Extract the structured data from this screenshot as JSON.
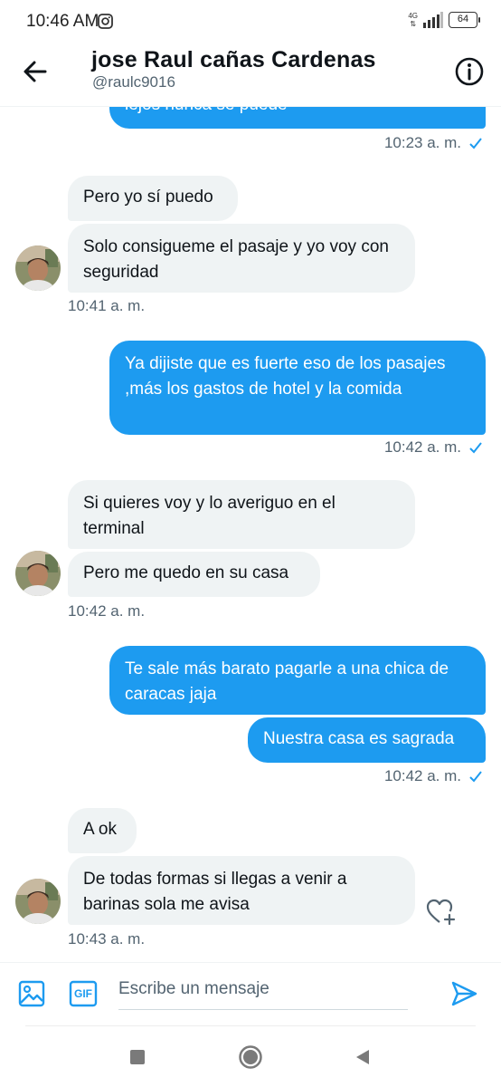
{
  "status_bar": {
    "time": "10:46 AM",
    "network": "4G",
    "battery": "64",
    "icons": [
      "instagram-icon",
      "signal-icon",
      "battery-icon"
    ]
  },
  "header": {
    "name": "jose Raul cañas Cardenas",
    "handle": "@raulc9016",
    "back_icon": "arrow-left-icon",
    "info_icon": "info-circle-icon"
  },
  "colors": {
    "accent": "#1d9bf0",
    "received_bubble": "#eff3f4",
    "secondary_text": "#536471"
  },
  "messages": {
    "partial_sent": {
      "text": "lejos nunca se puede",
      "time": "10:23 a. m."
    },
    "group1": {
      "items": [
        "Pero yo sí puedo",
        "Solo consigueme el pasaje y yo voy con seguridad"
      ],
      "time": "10:41 a. m."
    },
    "group2": {
      "items": [
        "Ya dijiste que es fuerte eso de los pasajes ,más los gastos de hotel y la comida"
      ],
      "time": "10:42 a. m."
    },
    "group3": {
      "items": [
        "Si quieres voy y lo averiguo en el terminal",
        "Pero me quedo en su casa"
      ],
      "time": "10:42 a. m."
    },
    "group4": {
      "items": [
        "Te sale más barato pagarle a una chica de caracas jaja",
        "Nuestra casa es sagrada"
      ],
      "time": "10:42 a. m."
    },
    "group5": {
      "items": [
        "A ok",
        "De todas formas si llegas a venir a barinas sola me avisa"
      ],
      "time": "10:43 a. m."
    }
  },
  "composer": {
    "placeholder": "Escribe un mensaje",
    "gif_label": "GIF",
    "icons": [
      "image-icon",
      "gif-icon",
      "send-icon"
    ]
  },
  "android_nav": {
    "icons": [
      "recents-square-icon",
      "home-circle-icon",
      "back-triangle-icon"
    ]
  }
}
